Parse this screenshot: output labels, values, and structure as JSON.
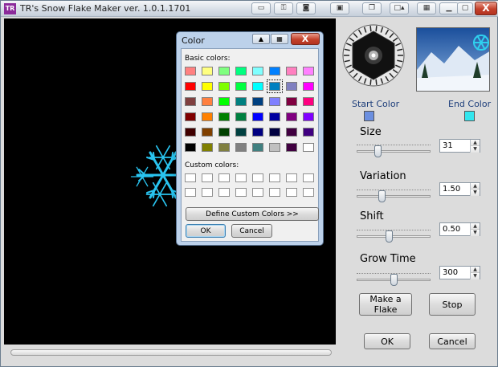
{
  "window": {
    "title": "TR's Snow Flake Maker ver. 1.0.1.1701",
    "app_icon": "TR",
    "close_label": "X"
  },
  "titlebar_icons": [
    "monitor-icon",
    "lock-icon",
    "camera-icon",
    "screenshot-icon",
    "windows-icon",
    "window-up-icon",
    "tray-icon",
    "minimize-icon",
    "maximize-icon"
  ],
  "preview": {
    "start_color_label": "Start Color",
    "end_color_label": "End Color",
    "start_color": "#6b8fe0",
    "end_color": "#33e6ee"
  },
  "controls": [
    {
      "label": "Size",
      "value": "31",
      "level": 0.27
    },
    {
      "label": "Variation",
      "value": "1.50",
      "level": 0.33
    },
    {
      "label": "Shift",
      "value": "0.50",
      "level": 0.43
    },
    {
      "label": "Grow Time",
      "value": "300",
      "level": 0.5
    }
  ],
  "buttons": {
    "make": "Make a Flake",
    "stop": "Stop",
    "ok": "OK",
    "cancel": "Cancel"
  },
  "color_dialog": {
    "title": "Color",
    "close_label": "X",
    "basic_colors_label": "Basic colors:",
    "custom_colors_label": "Custom colors:",
    "define_button": "Define Custom Colors >>",
    "ok_button": "OK",
    "cancel_button": "Cancel",
    "selected_index": 13,
    "basic_colors": [
      "#ff8080",
      "#ffff80",
      "#80ff80",
      "#00ff80",
      "#80ffff",
      "#0080ff",
      "#ff80c0",
      "#ff80ff",
      "#ff0000",
      "#ffff00",
      "#80ff00",
      "#00ff40",
      "#00ffff",
      "#0080c0",
      "#8080c0",
      "#ff00ff",
      "#804040",
      "#ff8040",
      "#00ff00",
      "#008080",
      "#004080",
      "#8080ff",
      "#800040",
      "#ff0080",
      "#800000",
      "#ff8000",
      "#008000",
      "#008040",
      "#0000ff",
      "#0000a0",
      "#800080",
      "#8000ff",
      "#400000",
      "#804000",
      "#004000",
      "#004040",
      "#000080",
      "#000040",
      "#400040",
      "#400080",
      "#000000",
      "#808000",
      "#808040",
      "#808080",
      "#408080",
      "#c0c0c0",
      "#400040",
      "#ffffff"
    ]
  }
}
